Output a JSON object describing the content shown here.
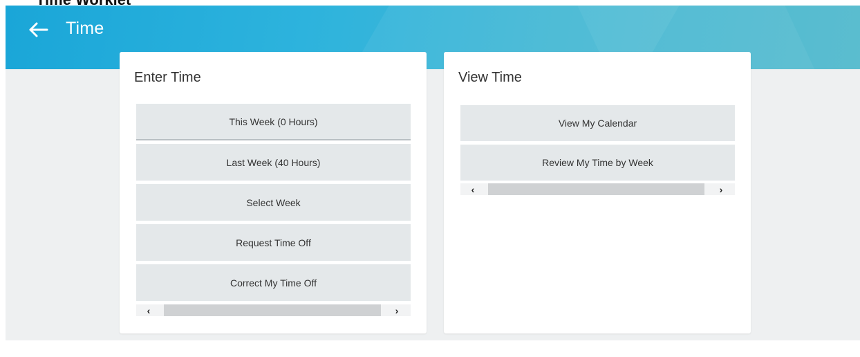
{
  "caption": "Time Worklet",
  "header": {
    "title": "Time",
    "back_icon": "arrow-left-icon"
  },
  "enter_time": {
    "title": "Enter Time",
    "items": [
      {
        "label": "This Week (0 Hours)"
      },
      {
        "label": "Last Week (40 Hours)"
      },
      {
        "label": "Select Week"
      },
      {
        "label": "Request Time Off"
      },
      {
        "label": "Correct My Time Off"
      }
    ],
    "scroll_left": "‹",
    "scroll_right": "›"
  },
  "view_time": {
    "title": "View Time",
    "items": [
      {
        "label": "View My Calendar"
      },
      {
        "label": "Review My Time by Week"
      }
    ],
    "scroll_left": "‹",
    "scroll_right": "›"
  },
  "colors": {
    "banner": "#1aa6d8",
    "background": "#eef0f1",
    "button": "#e4e8ea"
  }
}
